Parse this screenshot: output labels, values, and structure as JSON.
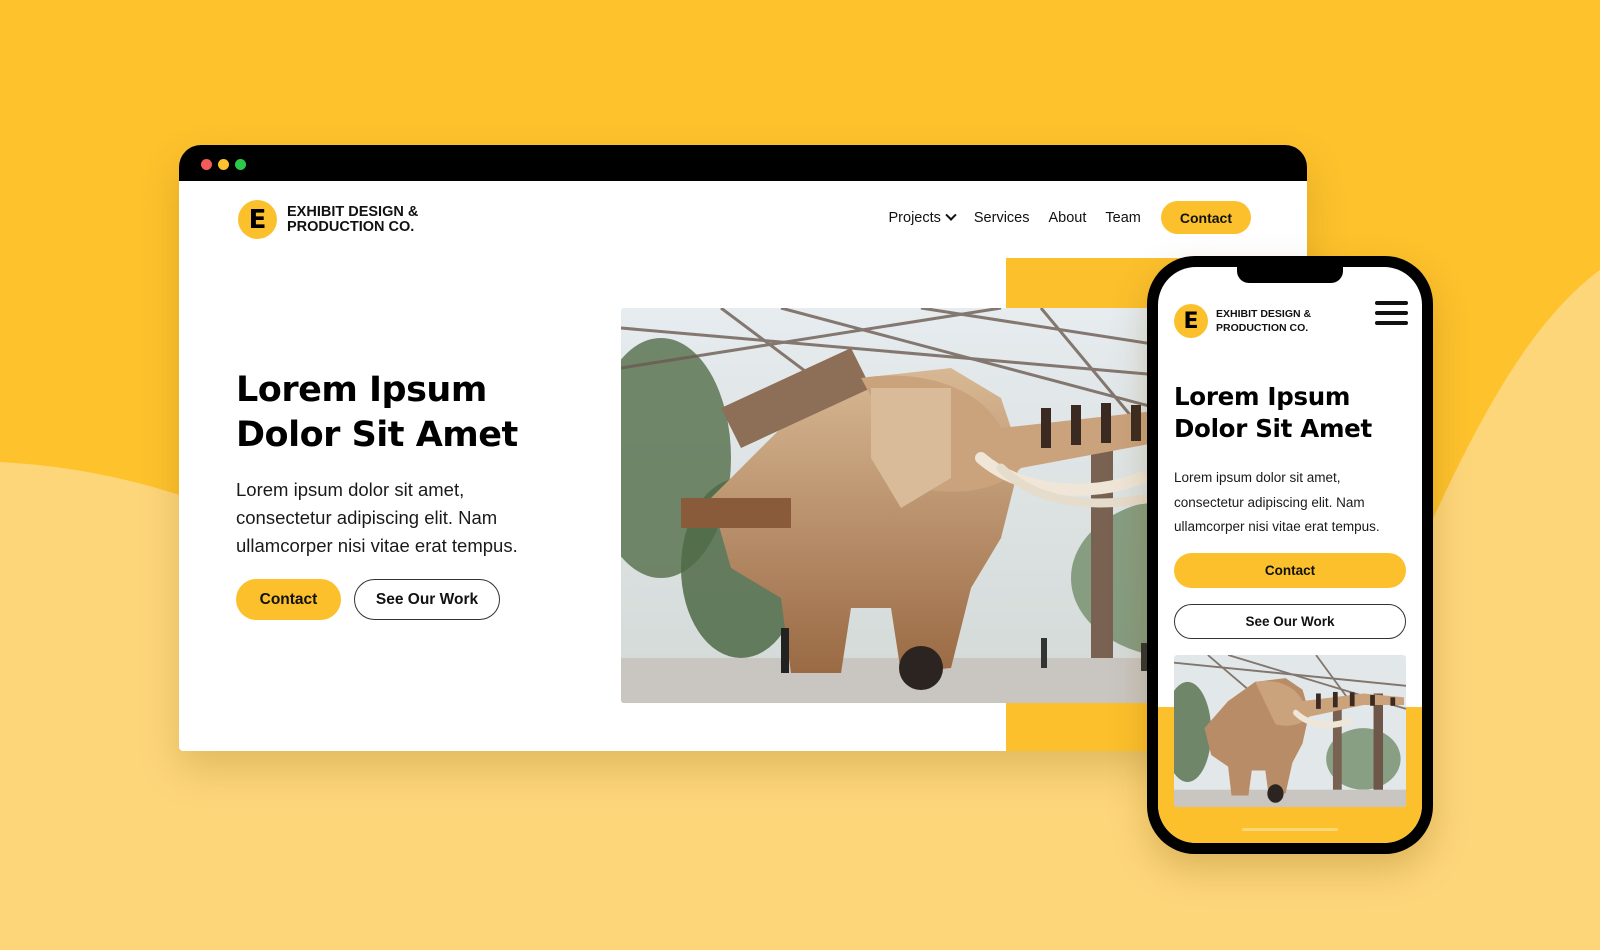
{
  "colors": {
    "background_primary": "#fec22d",
    "background_secondary": "#fed67a",
    "accent": "#fcc02c",
    "text": "#111111"
  },
  "browser_window": {
    "traffic_lights": [
      "close",
      "minimize",
      "maximize"
    ],
    "header": {
      "logo_letter": "E",
      "logo_line1": "EXHIBIT DESIGN &",
      "logo_line2": "PRODUCTION CO.",
      "nav": [
        {
          "label": "Projects",
          "has_dropdown": true
        },
        {
          "label": "Services"
        },
        {
          "label": "About"
        },
        {
          "label": "Team"
        }
      ],
      "contact_button": "Contact"
    },
    "hero": {
      "title_line1": "Lorem Ipsum",
      "title_line2": "Dolor Sit Amet",
      "body_line1": "Lorem ipsum dolor sit amet,",
      "body_line2": "consectetur adipiscing elit. Nam",
      "body_line3": "ullamcorper nisi vitae erat tempus.",
      "primary_button": "Contact",
      "secondary_button": "See Our Work",
      "image_alt": "Mechanical wooden elephant inside an industrial steel hall"
    }
  },
  "mobile": {
    "header": {
      "logo_letter": "E",
      "logo_line1": "EXHIBIT DESIGN &",
      "logo_line2": "PRODUCTION CO.",
      "menu_icon": "hamburger-icon"
    },
    "hero": {
      "title_line1": "Lorem Ipsum",
      "title_line2": "Dolor Sit Amet",
      "body_line1": "Lorem ipsum dolor sit amet,",
      "body_line2": "consectetur adipiscing elit. Nam",
      "body_line3": "ullamcorper nisi vitae erat tempus.",
      "primary_button": "Contact",
      "secondary_button": "See Our Work",
      "image_alt": "Mechanical wooden elephant inside an industrial steel hall"
    }
  }
}
